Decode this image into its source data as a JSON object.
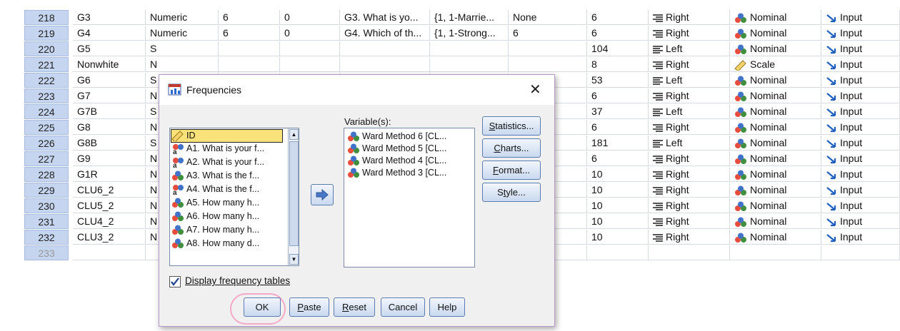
{
  "grid": {
    "rows": [
      {
        "num": "218",
        "name": "G3",
        "type": "Numeric",
        "width": "6",
        "decimals": "0",
        "label": "G3. What is yo...",
        "values": "{1, 1-Marrie...",
        "missing": "None",
        "columns": "6",
        "align": "Right",
        "measure": "Nominal",
        "role": "Input"
      },
      {
        "num": "219",
        "name": "G4",
        "type": "Numeric",
        "width": "6",
        "decimals": "0",
        "label": "G4. Which of th...",
        "values": "{1, 1-Strong...",
        "missing": "6",
        "columns": "6",
        "align": "Right",
        "measure": "Nominal",
        "role": "Input"
      },
      {
        "num": "220",
        "name": "G5",
        "type": "S",
        "width": "",
        "decimals": "",
        "label": "",
        "values": "",
        "missing": "",
        "columns": "104",
        "align": "Left",
        "measure": "Nominal",
        "role": "Input"
      },
      {
        "num": "221",
        "name": "Nonwhite",
        "type": "N",
        "width": "",
        "decimals": "",
        "label": "",
        "values": "",
        "missing": "",
        "columns": "8",
        "align": "Right",
        "measure": "Scale",
        "role": "Input"
      },
      {
        "num": "222",
        "name": "G6",
        "type": "S",
        "width": "",
        "decimals": "",
        "label": "",
        "values": "",
        "missing": "",
        "columns": "53",
        "align": "Left",
        "measure": "Nominal",
        "role": "Input"
      },
      {
        "num": "223",
        "name": "G7",
        "type": "N",
        "width": "",
        "decimals": "",
        "label": "",
        "values": "",
        "missing": "",
        "columns": "6",
        "align": "Right",
        "measure": "Nominal",
        "role": "Input"
      },
      {
        "num": "224",
        "name": "G7B",
        "type": "S",
        "width": "",
        "decimals": "",
        "label": "",
        "values": "",
        "missing": "",
        "columns": "37",
        "align": "Left",
        "measure": "Nominal",
        "role": "Input"
      },
      {
        "num": "225",
        "name": "G8",
        "type": "N",
        "width": "",
        "decimals": "",
        "label": "",
        "values": "",
        "missing": "",
        "columns": "6",
        "align": "Right",
        "measure": "Nominal",
        "role": "Input"
      },
      {
        "num": "226",
        "name": "G8B",
        "type": "S",
        "width": "",
        "decimals": "",
        "label": "",
        "values": "",
        "missing": "",
        "columns": "181",
        "align": "Left",
        "measure": "Nominal",
        "role": "Input"
      },
      {
        "num": "227",
        "name": "G9",
        "type": "N",
        "width": "",
        "decimals": "",
        "label": "",
        "values": "",
        "missing": "",
        "columns": "6",
        "align": "Right",
        "measure": "Nominal",
        "role": "Input"
      },
      {
        "num": "228",
        "name": "G1R",
        "type": "N",
        "width": "",
        "decimals": "",
        "label": "",
        "values": "",
        "missing": "",
        "columns": "10",
        "align": "Right",
        "measure": "Nominal",
        "role": "Input"
      },
      {
        "num": "229",
        "name": "CLU6_2",
        "type": "N",
        "width": "",
        "decimals": "",
        "label": "",
        "values": "",
        "missing": "",
        "columns": "10",
        "align": "Right",
        "measure": "Nominal",
        "role": "Input"
      },
      {
        "num": "230",
        "name": "CLU5_2",
        "type": "N",
        "width": "",
        "decimals": "",
        "label": "",
        "values": "",
        "missing": "",
        "columns": "10",
        "align": "Right",
        "measure": "Nominal",
        "role": "Input"
      },
      {
        "num": "231",
        "name": "CLU4_2",
        "type": "N",
        "width": "",
        "decimals": "",
        "label": "",
        "values": "",
        "missing": "",
        "columns": "10",
        "align": "Right",
        "measure": "Nominal",
        "role": "Input"
      },
      {
        "num": "232",
        "name": "CLU3_2",
        "type": "N",
        "width": "",
        "decimals": "",
        "label": "",
        "values": "",
        "missing": "",
        "columns": "10",
        "align": "Right",
        "measure": "Nominal",
        "role": "Input"
      },
      {
        "num": "233",
        "name": "",
        "type": "",
        "width": "",
        "decimals": "",
        "label": "",
        "values": "",
        "missing": "",
        "columns": "",
        "align": "",
        "measure": "",
        "role": ""
      }
    ]
  },
  "dialog": {
    "title": "Frequencies",
    "close": "✕",
    "source_list": [
      {
        "label": "ID",
        "icon": "ruler-icon"
      },
      {
        "label": "A1. What is your f...",
        "icon": "string-icon"
      },
      {
        "label": "A2. What is your f...",
        "icon": "string-icon"
      },
      {
        "label": "A3. What is the f...",
        "icon": "nominal-icon"
      },
      {
        "label": "A4. What is the f...",
        "icon": "string-icon"
      },
      {
        "label": "A5. How many h...",
        "icon": "nominal-icon"
      },
      {
        "label": "A6. How many h...",
        "icon": "nominal-icon"
      },
      {
        "label": "A7. How many h...",
        "icon": "nominal-icon"
      },
      {
        "label": "A8. How many d...",
        "icon": "nominal-icon"
      }
    ],
    "variables_label": "Variable(s):",
    "variables": [
      "Ward Method 6 [CL...",
      "Ward Method 5 [CL...",
      "Ward Method 4 [CL...",
      "Ward Method 3 [CL..."
    ],
    "side_buttons": [
      "Statistics...",
      "Charts...",
      "Format...",
      "Style..."
    ],
    "display_tables_label": "Display frequency tables",
    "display_tables_checked": true,
    "bottom_buttons": [
      "OK",
      "Paste",
      "Reset",
      "Cancel",
      "Help"
    ]
  },
  "colors": {
    "rownum_bg": "#c5d5ef",
    "highlight": "#f4a9c7",
    "selected": "#f9e27a",
    "button_border": "#5b7bb3"
  }
}
